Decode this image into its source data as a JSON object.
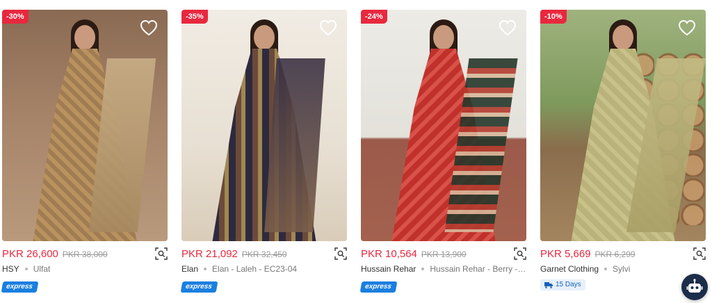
{
  "products": [
    {
      "discount": "-30%",
      "price": "PKR 26,600",
      "old_price": "PKR 38,000",
      "brand": "HSY",
      "name": "Ulfat",
      "badge_type": "express",
      "badge_text": "express"
    },
    {
      "discount": "-35%",
      "price": "PKR 21,092",
      "old_price": "PKR 32,450",
      "brand": "Elan",
      "name": "Elan - Laleh - EC23-04",
      "badge_type": "express",
      "badge_text": "express"
    },
    {
      "discount": "-24%",
      "price": "PKR 10,564",
      "old_price": "PKR 13,900",
      "brand": "Hussain Rehar",
      "name": "Hussain Rehar - Berry - ...",
      "badge_type": "express",
      "badge_text": "express"
    },
    {
      "discount": "-10%",
      "price": "PKR 5,669",
      "old_price": "PKR 6,299",
      "brand": "Garnet Clothing",
      "name": "Sylvi",
      "badge_type": "shipping",
      "badge_text": "15 Days"
    }
  ],
  "icons": {
    "wishlist": "heart-icon",
    "visual_search": "scan-search-icon",
    "shipping": "truck-icon",
    "chatbot": "robot-icon"
  },
  "colors": {
    "price": "#e8283e",
    "discount_bg": "#e8283e",
    "express_bg": "#1a7fe0",
    "shipping_bg": "#e7f0fb",
    "shipping_text": "#1a62b8",
    "chatbot_bg": "#1c2d4a"
  }
}
